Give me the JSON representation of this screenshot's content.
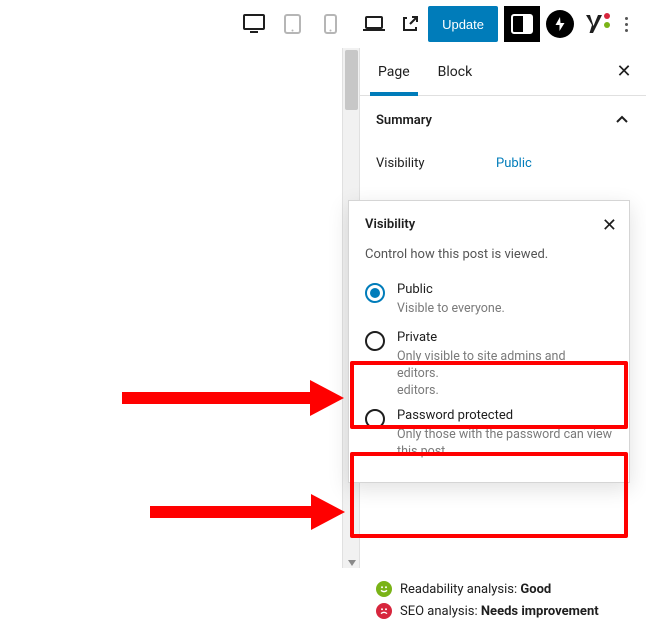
{
  "toolbar": {
    "update_label": "Update"
  },
  "panel": {
    "tabs": {
      "page": "Page",
      "block": "Block"
    },
    "summary_label": "Summary",
    "visibility_label": "Visibility",
    "visibility_value": "Public"
  },
  "popover": {
    "title": "Visibility",
    "desc": "Control how this post is viewed.",
    "options": [
      {
        "name": "Public",
        "hint": "Visible to everyone."
      },
      {
        "name": "Private",
        "hint": "Only visible to site admins and editors."
      },
      {
        "name": "Password protected",
        "hint": "Only those with the password can view this post."
      }
    ],
    "editors_overflow": "editors."
  },
  "analysis": {
    "readability_label": "Readability analysis: ",
    "readability_value": "Good",
    "seo_label": "SEO analysis: ",
    "seo_value": "Needs improvement"
  }
}
